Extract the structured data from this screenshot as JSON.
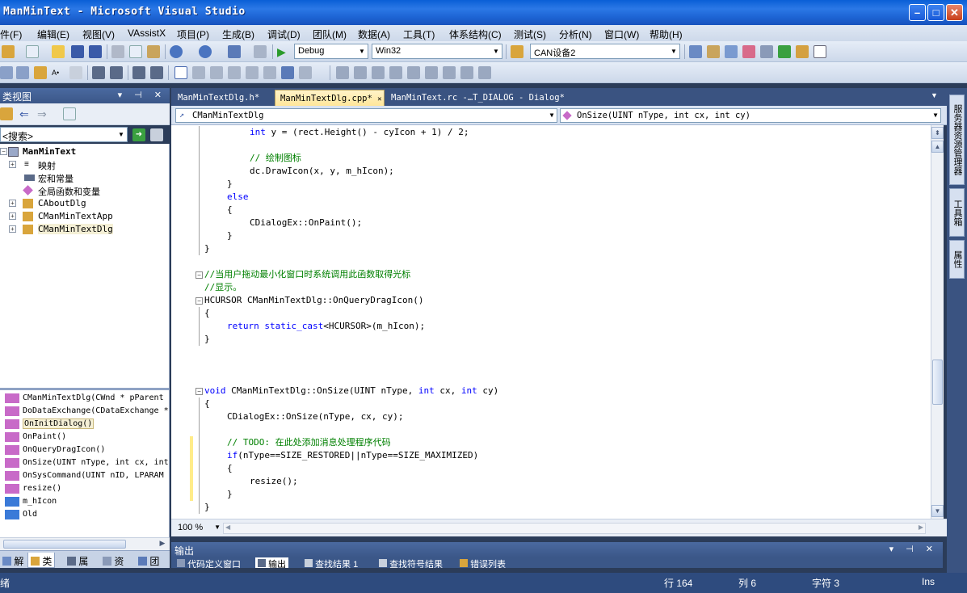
{
  "window": {
    "title": "ManMinText - Microsoft Visual Studio"
  },
  "menu": [
    "件(F)",
    "编辑(E)",
    "视图(V)",
    "VAssistX",
    "项目(P)",
    "生成(B)",
    "调试(D)",
    "团队(M)",
    "数据(A)",
    "工具(T)",
    "体系结构(C)",
    "测试(S)",
    "分析(N)",
    "窗口(W)",
    "帮助(H)"
  ],
  "toolbar": {
    "config": "Debug",
    "platform": "Win32",
    "find_target": "CAN设备2"
  },
  "class_view": {
    "title": "类视图",
    "search_placeholder": "<搜索>",
    "tree": [
      {
        "label": "ManMinText",
        "level": 0,
        "bold": true
      },
      {
        "label": "映射",
        "level": 1,
        "expandable": true
      },
      {
        "label": "宏和常量",
        "level": 1
      },
      {
        "label": "全局函数和变量",
        "level": 1
      },
      {
        "label": "CAboutDlg",
        "level": 0,
        "expandable": true
      },
      {
        "label": "CManMinTextApp",
        "level": 0,
        "expandable": true
      },
      {
        "label": "CManMinTextDlg",
        "level": 0,
        "expandable": true,
        "selected": true
      }
    ],
    "members": [
      {
        "label": "CManMinTextDlg(CWnd * pParent"
      },
      {
        "label": "DoDataExchange(CDataExchange *"
      },
      {
        "label": "OnInitDialog()",
        "selected": true
      },
      {
        "label": "OnPaint()"
      },
      {
        "label": "OnQueryDragIcon()"
      },
      {
        "label": "OnSize(UINT nType, int cx, int"
      },
      {
        "label": "OnSysCommand(UINT nID, LPARAM"
      },
      {
        "label": "resize()"
      },
      {
        "label": "m_hIcon"
      },
      {
        "label": "Old"
      }
    ],
    "bottom_tabs": [
      "解",
      "类",
      "属",
      "资",
      "团"
    ]
  },
  "editor": {
    "tabs": [
      {
        "label": "ManMinTextDlg.h*",
        "active": false
      },
      {
        "label": "ManMinTextDlg.cpp*",
        "active": true
      },
      {
        "label": "ManMinText.rc -…T_DIALOG - Dialog*",
        "active": false
      }
    ],
    "scope_combo": "CManMinTextDlg",
    "member_combo": "OnSize(UINT nType, int cx, int cy)",
    "zoom": "100 %",
    "lines": [
      {
        "text": "int y = (rect.Height() - cyIcon + 1) / 2;",
        "indent": 2,
        "kind": "code"
      },
      {
        "text": "",
        "indent": 0,
        "kind": "blank"
      },
      {
        "text": "// 绘制图标",
        "indent": 2,
        "kind": "comment"
      },
      {
        "text": "dc.DrawIcon(x, y, m_hIcon);",
        "indent": 2,
        "kind": "code"
      },
      {
        "text": "}",
        "indent": 1,
        "kind": "code"
      },
      {
        "text": "else",
        "indent": 1,
        "kind": "keyword"
      },
      {
        "text": "{",
        "indent": 1,
        "kind": "code"
      },
      {
        "text": "CDialogEx::OnPaint();",
        "indent": 2,
        "kind": "code"
      },
      {
        "text": "}",
        "indent": 1,
        "kind": "code"
      },
      {
        "text": "}",
        "indent": 0,
        "kind": "code"
      },
      {
        "text": "",
        "indent": 0,
        "kind": "blank"
      },
      {
        "text": "//当用户拖动最小化窗口时系统调用此函数取得光标",
        "indent": 0,
        "kind": "comment"
      },
      {
        "text": "//显示。",
        "indent": 0,
        "kind": "comment"
      },
      {
        "text": "HCURSOR CManMinTextDlg::OnQueryDragIcon()",
        "indent": 0,
        "kind": "code"
      },
      {
        "text": "{",
        "indent": 0,
        "kind": "code"
      },
      {
        "text": "return static_cast<HCURSOR>(m_hIcon);",
        "indent": 1,
        "kind": "return"
      },
      {
        "text": "}",
        "indent": 0,
        "kind": "code"
      },
      {
        "text": "",
        "indent": 0,
        "kind": "blank"
      },
      {
        "text": "",
        "indent": 0,
        "kind": "blank"
      },
      {
        "text": "",
        "indent": 0,
        "kind": "blank"
      },
      {
        "text": "void CManMinTextDlg::OnSize(UINT nType, int cx, int cy)",
        "indent": 0,
        "kind": "sig"
      },
      {
        "text": "{",
        "indent": 0,
        "kind": "code"
      },
      {
        "text": "CDialogEx::OnSize(nType, cx, cy);",
        "indent": 1,
        "kind": "code"
      },
      {
        "text": "",
        "indent": 0,
        "kind": "blank"
      },
      {
        "text": "// TODO: 在此处添加消息处理程序代码",
        "indent": 1,
        "kind": "comment"
      },
      {
        "text": "if(nType==SIZE_RESTORED||nType==SIZE_MAXIMIZED)",
        "indent": 1,
        "kind": "if"
      },
      {
        "text": "{",
        "indent": 1,
        "kind": "code"
      },
      {
        "text": "resize();",
        "indent": 2,
        "kind": "code"
      },
      {
        "text": "}",
        "indent": 1,
        "kind": "code"
      },
      {
        "text": "}",
        "indent": 0,
        "kind": "code"
      }
    ]
  },
  "output": {
    "title": "输出",
    "tabs": [
      "代码定义窗口",
      "输出",
      "查找结果 1",
      "查找符号结果",
      "错误列表"
    ]
  },
  "right_strip": [
    "服务器资源管理器",
    "工具箱",
    "属性"
  ],
  "status": {
    "ready": "绪",
    "line": "行 164",
    "col": "列 6",
    "char": "字符 3",
    "mode": "Ins"
  }
}
